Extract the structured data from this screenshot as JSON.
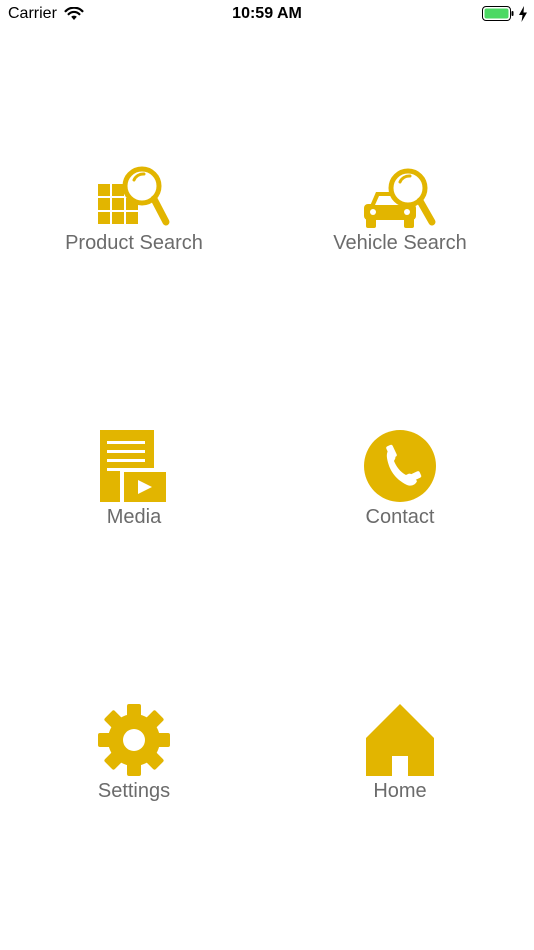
{
  "status_bar": {
    "carrier": "Carrier",
    "time": "10:59 AM"
  },
  "accent_color": "#e2b500",
  "menu": [
    {
      "label": "Product Search",
      "icon": "grid-search-icon"
    },
    {
      "label": "Vehicle Search",
      "icon": "car-search-icon"
    },
    {
      "label": "Media",
      "icon": "media-icon"
    },
    {
      "label": "Contact",
      "icon": "phone-icon"
    },
    {
      "label": "Settings",
      "icon": "gear-icon"
    },
    {
      "label": "Home",
      "icon": "home-icon"
    }
  ]
}
